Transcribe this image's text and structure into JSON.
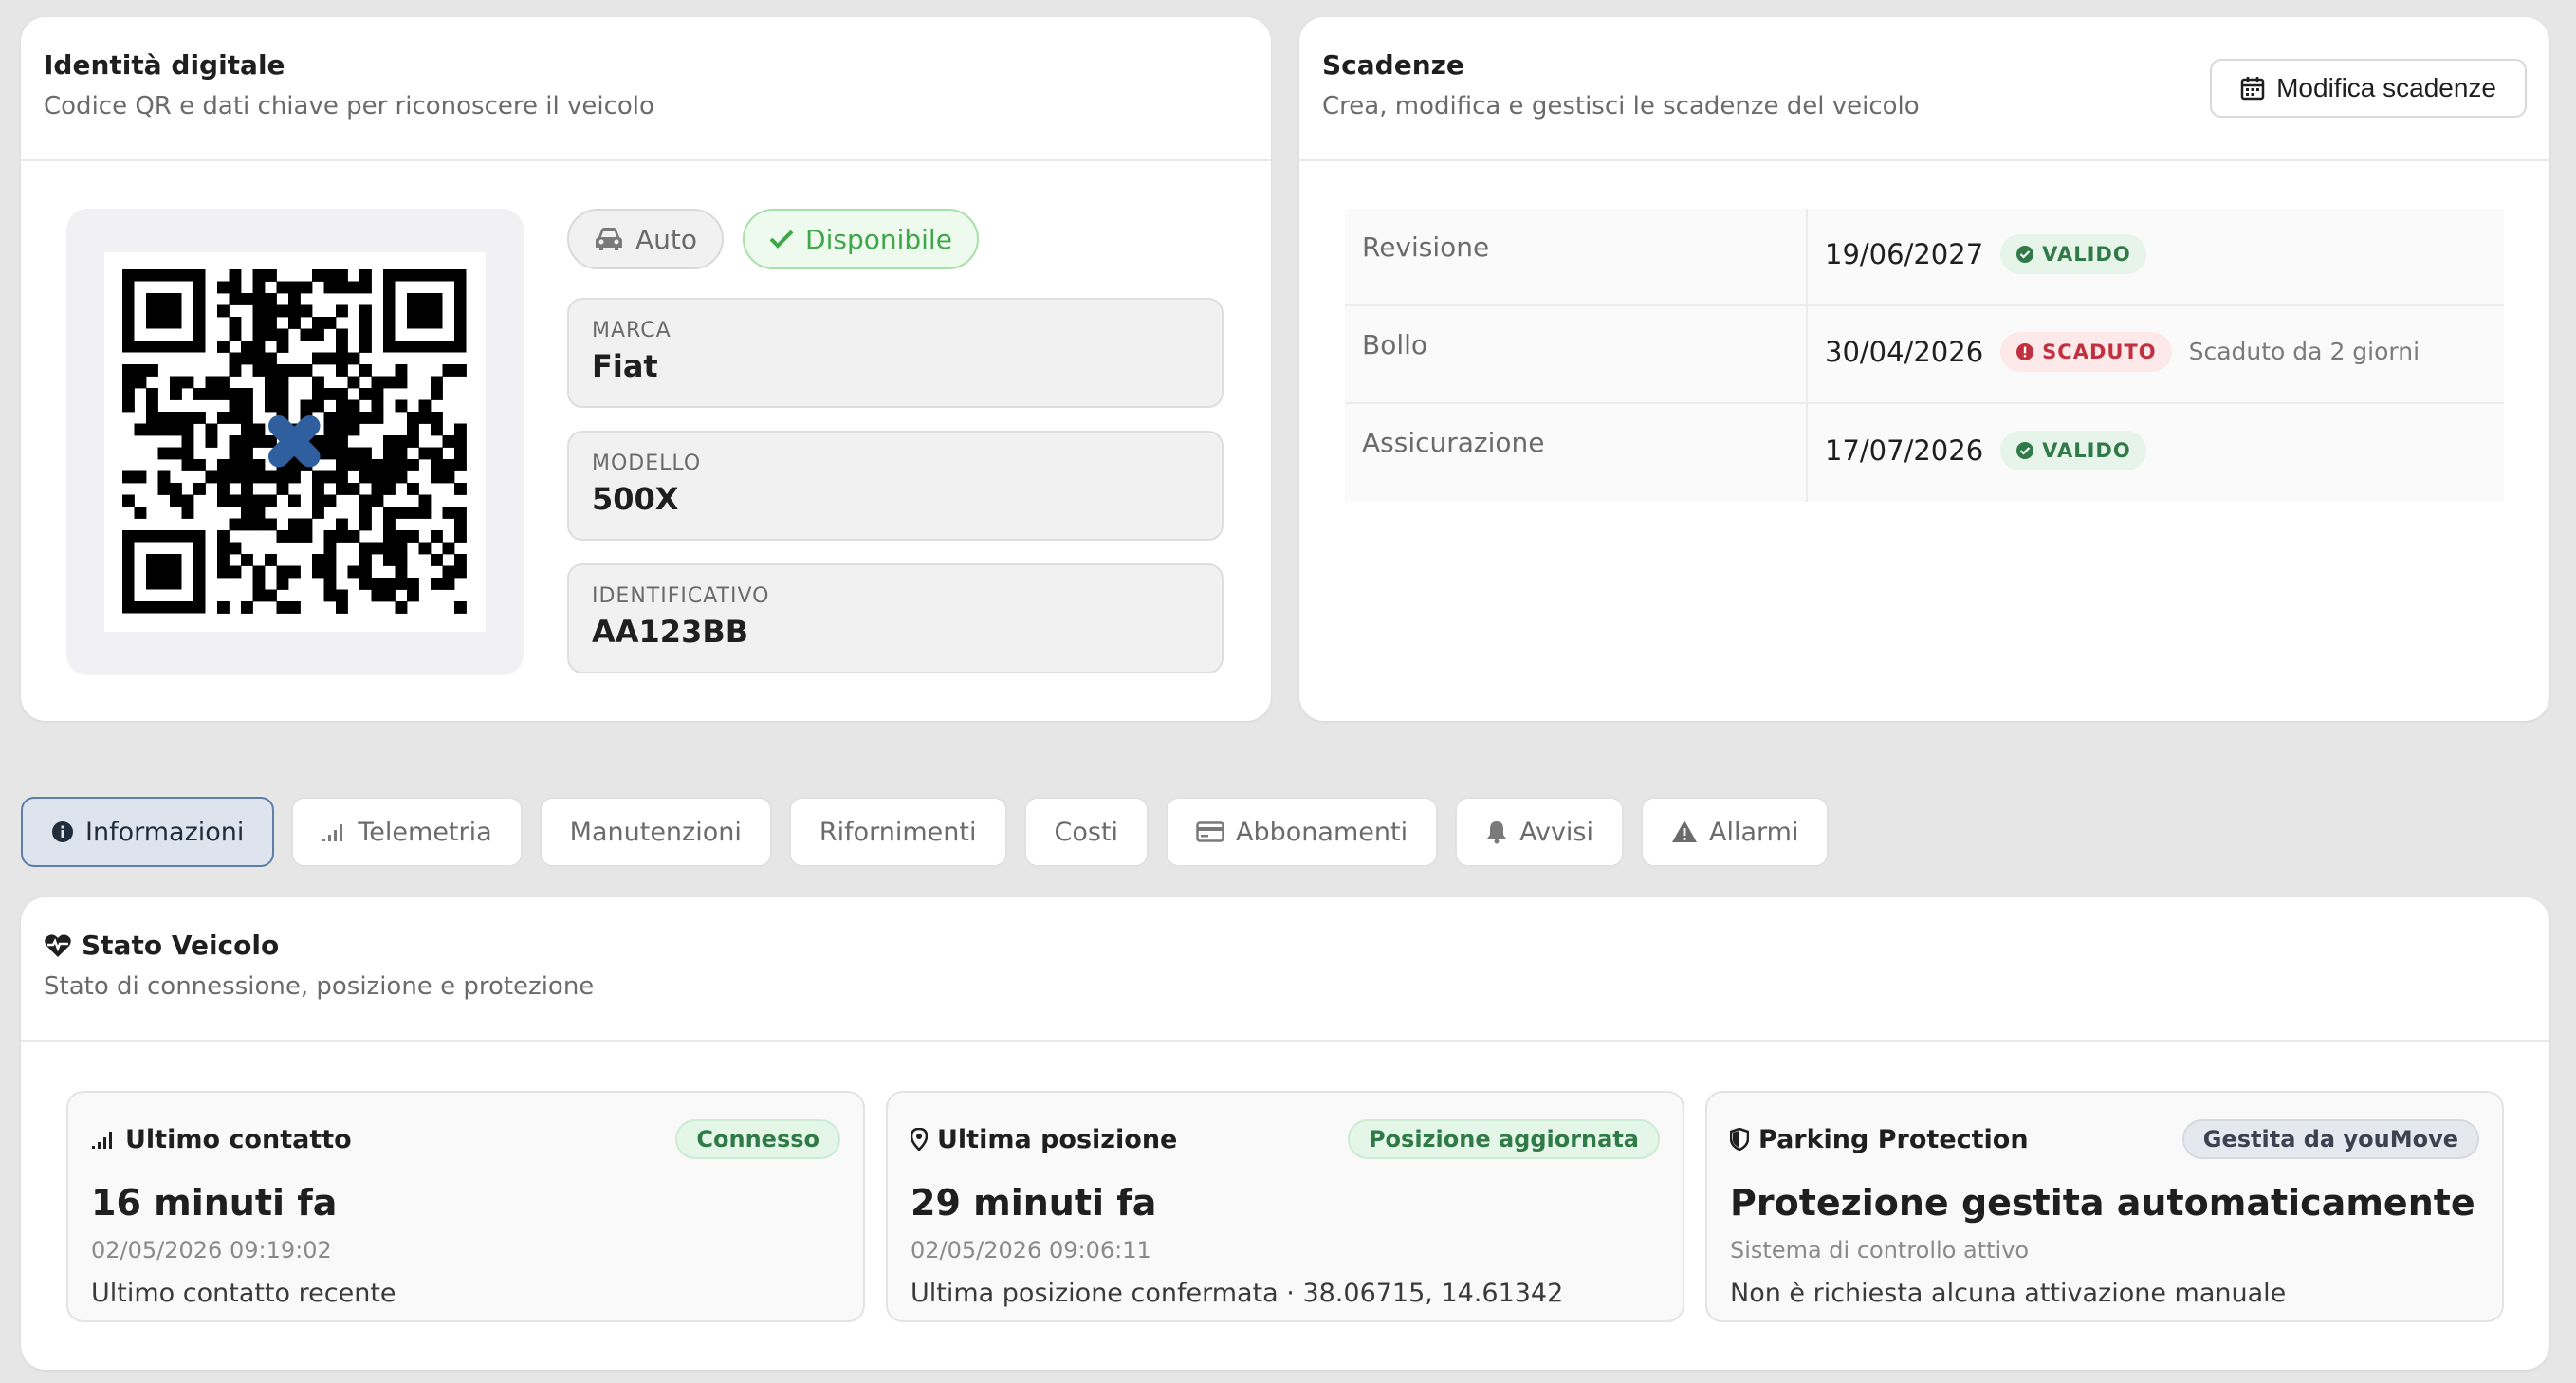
{
  "identity": {
    "title": "Identità digitale",
    "subtitle": "Codice QR e dati chiave per riconoscere il veicolo",
    "type_pill": "Auto",
    "status_pill": "Disponibile",
    "fields": [
      {
        "label": "MARCA",
        "value": "Fiat"
      },
      {
        "label": "MODELLO",
        "value": "500X"
      },
      {
        "label": "IDENTIFICATIVO",
        "value": "AA123BB"
      }
    ]
  },
  "deadlines": {
    "title": "Scadenze",
    "subtitle": "Crea, modifica e gestisci le scadenze del veicolo",
    "edit_button": "Modifica scadenze",
    "rows": [
      {
        "name": "Revisione",
        "date": "19/06/2027",
        "badge": "VALIDO",
        "note": ""
      },
      {
        "name": "Bollo",
        "date": "30/04/2026",
        "badge": "SCADUTO",
        "note": "Scaduto da 2 giorni"
      },
      {
        "name": "Assicurazione",
        "date": "17/07/2026",
        "badge": "VALIDO",
        "note": ""
      }
    ]
  },
  "tabs": [
    "Informazioni",
    "Telemetria",
    "Manutenzioni",
    "Rifornimenti",
    "Costi",
    "Abbonamenti",
    "Avvisi",
    "Allarmi"
  ],
  "status": {
    "title": "Stato Veicolo",
    "subtitle": "Stato di connessione, posizione e protezione",
    "cards": [
      {
        "title": "Ultimo contatto",
        "tag": "Connesso",
        "big": "16 minuti fa",
        "small": "02/05/2026 09:19:02",
        "desc": "Ultimo contatto recente"
      },
      {
        "title": "Ultima posizione",
        "tag": "Posizione aggiornata",
        "big": "29 minuti fa",
        "small": "02/05/2026 09:06:11",
        "desc": "Ultima posizione confermata · 38.06715, 14.61342"
      },
      {
        "title": "Parking Protection",
        "tag": "Gestita da youMove",
        "big": "Protezione gestita automaticamente",
        "small": "Sistema di controllo attivo",
        "desc": "Non è richiesta alcuna attivazione manuale"
      }
    ]
  },
  "colors": {
    "accent_blue": "#5d7fa8",
    "valid_green": "#2f7a46",
    "expired_red": "#c0303f",
    "available_green": "#3fa64a"
  }
}
